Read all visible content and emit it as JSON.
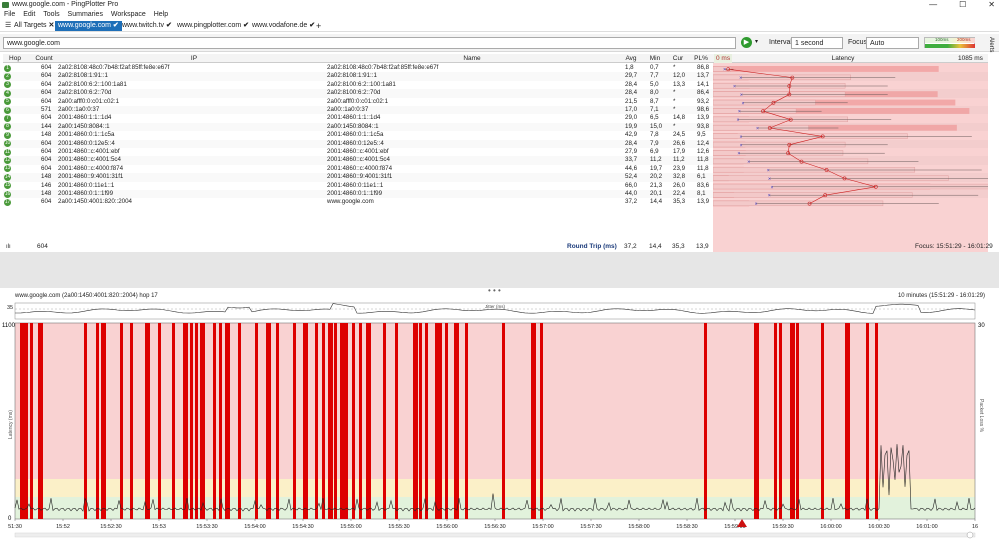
{
  "window": {
    "title": "www.google.com - PingPlotter Pro",
    "controls": [
      "—",
      "☐",
      "✕"
    ]
  },
  "menu": [
    "File",
    "Edit",
    "Tools",
    "Summaries",
    "Workspace",
    "Help"
  ],
  "tabs": {
    "all_targets": "All Targets",
    "items": [
      {
        "label": "www.google.com",
        "active": true
      },
      {
        "label": "www.twitch.tv",
        "active": false
      },
      {
        "label": "www.pingplotter.com",
        "active": false
      },
      {
        "label": "www.vodafone.de",
        "active": false
      }
    ],
    "add": "+"
  },
  "toolbar": {
    "target_value": "www.google.com",
    "interval_label": "Interval",
    "interval_value": "1 second",
    "focus_label": "Focus",
    "focus_value": "Auto",
    "legend_low": "100ms",
    "legend_high": "200ms",
    "alerts_label": "Alerts"
  },
  "grid": {
    "headers": {
      "hop": "Hop",
      "count": "Count",
      "ip": "IP",
      "name": "Name",
      "avg": "Avg",
      "min": "Min",
      "cur": "Cur",
      "pl": "PL%",
      "scale_start": "0 ms",
      "latency": "Latency",
      "scale_end": "1085 ms"
    },
    "rows": [
      {
        "hop": "1",
        "count": "604",
        "ip": "2a02:8108:48c0:7b48:f2af:85ff:fe8e:e67f",
        "name": "2a02:8108:48c0:7b48:f2af:85ff:fe8e:e67f",
        "avg": "1,8",
        "min": "0,7",
        "cur": "*",
        "pl": "86,8"
      },
      {
        "hop": "2",
        "count": "604",
        "ip": "2a02:8108:1:91::1",
        "name": "2a02:8108:1:91::1",
        "avg": "29,7",
        "min": "7,7",
        "cur": "12,0",
        "pl": "13,7"
      },
      {
        "hop": "3",
        "count": "604",
        "ip": "2a02:8100:6:2::100:1a81",
        "name": "2a02:8100:6:2::100:1a81",
        "avg": "28,4",
        "min": "5,0",
        "cur": "13,3",
        "pl": "14,1"
      },
      {
        "hop": "4",
        "count": "604",
        "ip": "2a02:8100:6:2::70d",
        "name": "2a02:8100:6:2::70d",
        "avg": "28,4",
        "min": "8,0",
        "cur": "*",
        "pl": "86,4"
      },
      {
        "hop": "5",
        "count": "604",
        "ip": "2a00:afff0:0:c01:c02:1",
        "name": "2a00:afff0:0:c01:c02:1",
        "avg": "21,5",
        "min": "8,7",
        "cur": "*",
        "pl": "93,2"
      },
      {
        "hop": "6",
        "count": "571",
        "ip": "2a00::1a0:0:37",
        "name": "2a00::1a0:0:37",
        "avg": "17,0",
        "min": "7,1",
        "cur": "*",
        "pl": "98,6"
      },
      {
        "hop": "7",
        "count": "604",
        "ip": "2001:4860:1:1::1d4",
        "name": "2001:4860:1:1::1d4",
        "avg": "29,0",
        "min": "6,5",
        "cur": "14,8",
        "pl": "13,9"
      },
      {
        "hop": "8",
        "count": "144",
        "ip": "2a00:1450:8084::1",
        "name": "2a00:1450:8084::1",
        "avg": "19,9",
        "min": "15,0",
        "cur": "*",
        "pl": "93,8"
      },
      {
        "hop": "9",
        "count": "148",
        "ip": "2001:4860:0:1::1c5a",
        "name": "2001:4860:0:1::1c5a",
        "avg": "42,9",
        "min": "7,8",
        "cur": "24,5",
        "pl": "9,5"
      },
      {
        "hop": "10",
        "count": "604",
        "ip": "2001:4860:0:12e5::4",
        "name": "2001:4860:0:12e5::4",
        "avg": "28,4",
        "min": "7,9",
        "cur": "26,6",
        "pl": "12,4"
      },
      {
        "hop": "11",
        "count": "604",
        "ip": "2001:4860::c:4001:ebf",
        "name": "2001:4860::c:4001:ebf",
        "avg": "27,9",
        "min": "6,9",
        "cur": "17,9",
        "pl": "12,6"
      },
      {
        "hop": "12",
        "count": "604",
        "ip": "2001:4860::c:4001:5c4",
        "name": "2001:4860::c:4001:5c4",
        "avg": "33,7",
        "min": "11,2",
        "cur": "11,2",
        "pl": "11,8"
      },
      {
        "hop": "13",
        "count": "604",
        "ip": "2001:4860::c:4000:f874",
        "name": "2001:4860::c:4000:f874",
        "avg": "44,6",
        "min": "19,7",
        "cur": "23,9",
        "pl": "11,8"
      },
      {
        "hop": "14",
        "count": "148",
        "ip": "2001:4860::9:4001:31f1",
        "name": "2001:4860::9:4001:31f1",
        "avg": "52,4",
        "min": "20,2",
        "cur": "32,8",
        "pl": "6,1"
      },
      {
        "hop": "15",
        "count": "146",
        "ip": "2001:4860:0:11e1::1",
        "name": "2001:4860:0:11e1::1",
        "avg": "66,0",
        "min": "21,3",
        "cur": "26,0",
        "pl": "83,6"
      },
      {
        "hop": "16",
        "count": "148",
        "ip": "2001:4860:0:1::1f99",
        "name": "2001:4860:0:1::1f99",
        "avg": "44,0",
        "min": "20,1",
        "cur": "22,4",
        "pl": "8,1"
      },
      {
        "hop": "17",
        "count": "604",
        "ip": "2a00:1450:4001:820::2004",
        "name": "www.google.com",
        "avg": "37,2",
        "min": "14,4",
        "cur": "35,3",
        "pl": "13,9"
      }
    ],
    "summary": {
      "count": "604",
      "label": "Round Trip (ms)",
      "avg": "37,2",
      "min": "14,4",
      "cur": "35,3",
      "pl": "13,9",
      "focus": "Focus: 15:51:29 - 16:01:29"
    },
    "colors": {
      "hop_ok": "#4a9a3a",
      "latency_bg": "#f9d2d2",
      "bar": "#f0a0a0",
      "min_mark": "#cc2222"
    }
  },
  "timeline": {
    "title": "www.google.com (2a00:1450:4001:820::2004) hop 17",
    "range": "10 minutes (15:51:29 - 16:01:29)",
    "jitter_label": "Jitter (ms)",
    "jitter_left": "35",
    "y_top": "1100",
    "y_bottom": "0",
    "y_axis_label": "Latency (ms)",
    "pl_top": "30",
    "pl_axis_label": "Packet Loss %",
    "x_ticks": [
      "51:30",
      "15:52",
      "15:52:30",
      "15:53",
      "15:53:30",
      "15:54:00",
      "15:54:30",
      "15:55:00",
      "15:55:30",
      "15:56:00",
      "15:56:30",
      "15:57:00",
      "15:57:30",
      "15:58:00",
      "15:58:30",
      "15:59:00",
      "15:59:30",
      "16:00:00",
      "16:00:30",
      "16:01:00",
      "16"
    ],
    "colors": {
      "bg_red": "#f9d2d2",
      "bg_yellow": "#fbf0c8",
      "bg_green": "#e2f2dc",
      "loss": "#dd0000",
      "line": "#222222"
    }
  }
}
